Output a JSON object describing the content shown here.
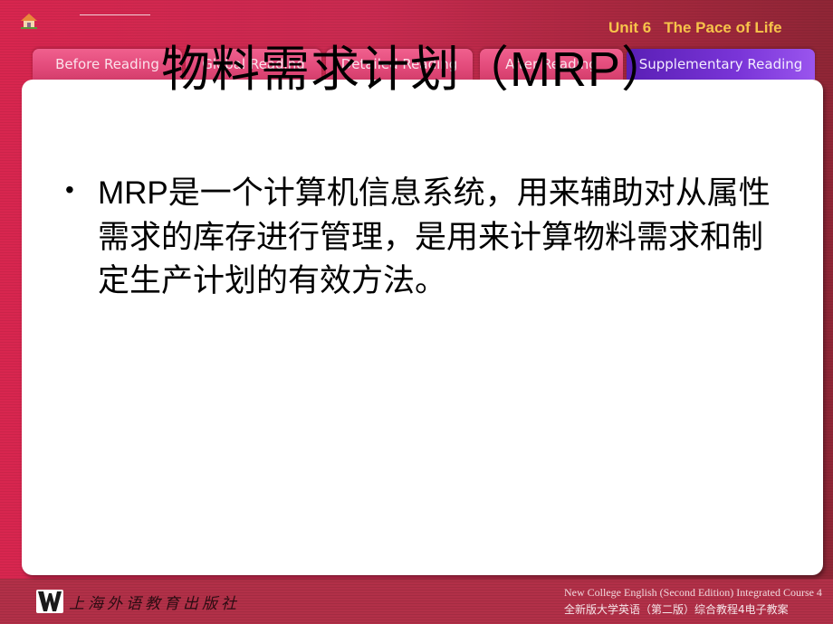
{
  "header": {
    "home_icon": "home-icon",
    "unit_label": "Unit 6",
    "unit_title": "The Pace of Life"
  },
  "tabs": [
    {
      "label": "Before Reading",
      "active": false
    },
    {
      "label": "Global Reading",
      "active": false
    },
    {
      "label": "Detailed Reading",
      "active": false
    },
    {
      "label": "After Reading",
      "active": false
    },
    {
      "label": "Supplementary Reading",
      "active": true
    }
  ],
  "slide": {
    "title_cn": "物料需求计划（",
    "title_latin": "MRP",
    "title_close": "）",
    "bullets": [
      {
        "lead_latin": "MRP",
        "text": "是一个计算机信息系统，用来辅助对从属性需求的库存进行管理，是用来计算物料需求和制定生产计划的有效方法。"
      }
    ]
  },
  "footer": {
    "publisher_logo": "W",
    "publisher_name": "上海外语教育出版社",
    "course_en": "New College English (Second Edition) Integrated Course 4",
    "course_cn": "全新版大学英语（第二版）综合教程4电子教案"
  }
}
